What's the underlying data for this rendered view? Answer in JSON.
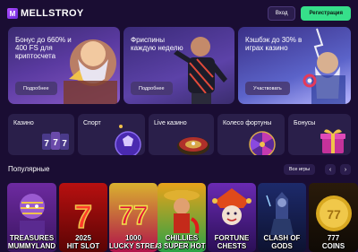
{
  "header": {
    "logo_mark": "M",
    "logo_text": "MELLSTROY",
    "login_label": "Вход",
    "register_label": "Регистрация"
  },
  "promos": [
    {
      "title": "Бонус до 660% и 400 FS для криптосчета",
      "button": "Подробнее"
    },
    {
      "title": "Фриспины каждую неделю",
      "button": "Подробнее"
    },
    {
      "title": "Кэшбэк до 30% в играх казино",
      "button": "Участвовать"
    }
  ],
  "categories": [
    {
      "label": "Казино",
      "icon": "casino-777-icon"
    },
    {
      "label": "Спорт",
      "icon": "football-icon"
    },
    {
      "label": "Live казино",
      "icon": "roulette-icon"
    },
    {
      "label": "Колесо фортуны",
      "icon": "fortune-wheel-icon"
    },
    {
      "label": "Бонусы",
      "icon": "gift-icon"
    }
  ],
  "popular": {
    "title": "Популярные",
    "all_label": "Все игры",
    "prev_icon": "‹",
    "next_icon": "›",
    "games": [
      {
        "name": "MUMMYLAND",
        "sub": "TREASURES"
      },
      {
        "name": "HIT SLOT",
        "sub": "2025"
      },
      {
        "name": "LUCKY STREAK",
        "sub": "1000"
      },
      {
        "name": "3 SUPER HOT",
        "sub": "CHILLIES"
      },
      {
        "name": "FORTUNE",
        "sub": "CHESTS"
      },
      {
        "name": "CLASH OF",
        "sub": "GODS"
      },
      {
        "name": "777",
        "sub": "COINS"
      }
    ]
  },
  "colors": {
    "background": "#1a0d33",
    "accent_green": "#36e08a",
    "tile": "#2a1f4a"
  }
}
